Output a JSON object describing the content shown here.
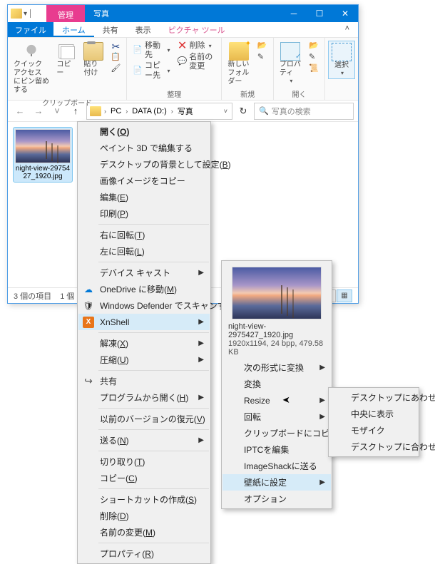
{
  "titlebar": {
    "manage": "管理",
    "title": "写真"
  },
  "winbtns": {
    "min": "─",
    "max": "☐",
    "close": "✕"
  },
  "menubar": {
    "file": "ファイル",
    "home": "ホーム",
    "share": "共有",
    "display": "表示",
    "picture": "ピクチャ ツール"
  },
  "ribbon": {
    "quickaccess": "クイック アクセス\nにピン留めする",
    "copy": "コピー",
    "paste": "貼り付け",
    "moveTo": "移動先",
    "copyTo": "コピー先",
    "delete": "削除",
    "rename": "名前の変更",
    "newFolder": "新しい\nフォルダー",
    "properties": "プロパティ",
    "select": "選択",
    "grpClipboard": "クリップボード",
    "grpOrganize": "整理",
    "grpNew": "新規",
    "grpOpen": "開く"
  },
  "nav": {
    "refresh": "↻"
  },
  "address": {
    "pc": "PC",
    "drive": "DATA (D:)",
    "folder": "写真"
  },
  "search": {
    "placeholder": "写真の検索",
    "icon": "🔍"
  },
  "thumbs": {
    "selected": "night-view-29754\n27_1920.jpg"
  },
  "status": {
    "count": "3 個の項目",
    "sel": "1 個"
  },
  "ctx1": {
    "open_pre": "開く(",
    "open_u": "O",
    "open_post": ")",
    "paint3d": "ペイント 3D で編集する",
    "setbg_pre": "デスクトップの背景として設定(",
    "setbg_u": "B",
    "setbg_post": ")",
    "imgcopy": "画像イメージをコピー",
    "edit_pre": "編集(",
    "edit_u": "E",
    "edit_post": ")",
    "print_pre": "印刷(",
    "print_u": "P",
    "print_post": ")",
    "rotr_pre": "右に回転(",
    "rotr_u": "T",
    "rotr_post": ")",
    "rotl_pre": "左に回転(",
    "rotl_u": "L",
    "rotl_post": ")",
    "cast": "デバイス キャスト",
    "onedrive_pre": "OneDrive に移動(",
    "onedrive_u": "M",
    "onedrive_post": ")",
    "defender": "Windows Defender でスキャンする...",
    "xnshell": "XnShell",
    "extract_pre": "解凍(",
    "extract_u": "X",
    "extract_post": ")",
    "compress_pre": "圧縮(",
    "compress_u": "U",
    "compress_post": ")",
    "share": "共有",
    "openwith_pre": "プログラムから開く(",
    "openwith_u": "H",
    "openwith_post": ")",
    "restore_pre": "以前のバージョンの復元(",
    "restore_u": "V",
    "restore_post": ")",
    "send_pre": "送る(",
    "send_u": "N",
    "send_post": ")",
    "cut_pre": "切り取り(",
    "cut_u": "T",
    "cut_post": ")",
    "copy_pre": "コピー(",
    "copy_u": "C",
    "copy_post": ")",
    "shortcut_pre": "ショートカットの作成(",
    "shortcut_u": "S",
    "shortcut_post": ")",
    "delete_pre": "削除(",
    "delete_u": "D",
    "delete_post": ")",
    "rename_pre": "名前の変更(",
    "rename_u": "M",
    "rename_post": ")",
    "prop_pre": "プロパティ(",
    "prop_u": "R",
    "prop_post": ")",
    "xn_label": "X"
  },
  "ctx2": {
    "filename": "night-view-2975427_1920.jpg",
    "meta": "1920x1194, 24 bpp, 479.58 KB",
    "convertNext": "次の形式に変換",
    "convert": "変換",
    "resize": "Resize",
    "rotate": "回転",
    "clipcopy": "クリップボードにコピー",
    "iptc": "IPTCを編集",
    "imageshack": "ImageShackに送る",
    "wallpaper": "壁紙に設定",
    "options": "オプション"
  },
  "ctx3": {
    "fit": "デスクトップにあわせる",
    "center": "中央に表示",
    "mosaic": "モザイク",
    "fit2": "デスクトップに合わせる"
  }
}
